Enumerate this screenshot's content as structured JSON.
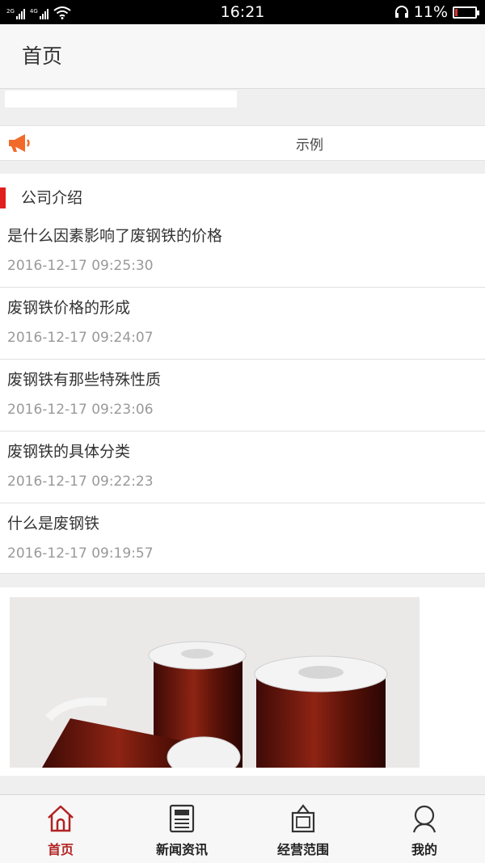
{
  "status_bar": {
    "time": "16:21",
    "battery": "11%",
    "network_labels": [
      "2G",
      "4G"
    ]
  },
  "header": {
    "title": "首页"
  },
  "notice": {
    "text": "示例",
    "icon": "megaphone-icon"
  },
  "section": {
    "title": "公司介绍",
    "items": [
      {
        "title": "是什么因素影响了废钢铁的价格",
        "date": "2016-12-17 09:25:30"
      },
      {
        "title": "废钢铁价格的形成",
        "date": "2016-12-17 09:24:07"
      },
      {
        "title": "废钢铁有那些特殊性质",
        "date": "2016-12-17 09:23:06"
      },
      {
        "title": "废钢铁的具体分类",
        "date": "2016-12-17 09:22:23"
      },
      {
        "title": "什么是废钢铁",
        "date": "2016-12-17 09:19:57"
      }
    ]
  },
  "tabs": [
    {
      "label": "首页",
      "icon": "home-icon",
      "active": true
    },
    {
      "label": "新闻资讯",
      "icon": "newspaper-icon",
      "active": false
    },
    {
      "label": "经营范围",
      "icon": "frame-icon",
      "active": false
    },
    {
      "label": "我的",
      "icon": "user-icon",
      "active": false
    }
  ],
  "colors": {
    "accent": "#e01f1f",
    "tab_active": "#b22222",
    "notice_icon": "#f26a2a"
  }
}
